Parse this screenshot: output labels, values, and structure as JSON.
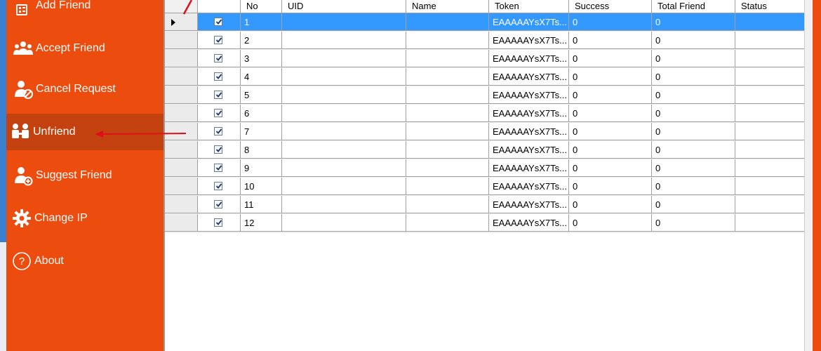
{
  "sidebar": {
    "items": [
      {
        "label": "Add Friend",
        "icon": "add-friend-icon",
        "active": false
      },
      {
        "label": "Accept Friend",
        "icon": "group-users-icon",
        "active": false
      },
      {
        "label": "Cancel Request",
        "icon": "user-cancel-icon",
        "active": false
      },
      {
        "label": "Unfriend",
        "icon": "unfriend-icon",
        "active": true
      },
      {
        "label": "Suggest Friend",
        "icon": "user-add-icon",
        "active": false
      },
      {
        "label": "Change IP",
        "icon": "gear-icon",
        "active": false
      },
      {
        "label": "About",
        "icon": "question-circle-icon",
        "active": false
      }
    ]
  },
  "grid": {
    "columns": [
      "",
      "No",
      "UID",
      "Name",
      "Token",
      "Success",
      "Total Friend",
      "Status"
    ],
    "rows": [
      {
        "no": "1",
        "uid": "",
        "name": "",
        "token": "EAAAAAYsX7Ts...",
        "success": "0",
        "total": "0",
        "status": "",
        "checked": true,
        "selected": true
      },
      {
        "no": "2",
        "uid": "",
        "name": "",
        "token": "EAAAAAYsX7Ts...",
        "success": "0",
        "total": "0",
        "status": "",
        "checked": true,
        "selected": false
      },
      {
        "no": "3",
        "uid": "",
        "name": "",
        "token": "EAAAAAYsX7Ts...",
        "success": "0",
        "total": "0",
        "status": "",
        "checked": true,
        "selected": false
      },
      {
        "no": "4",
        "uid": "",
        "name": "",
        "token": "EAAAAAYsX7Ts...",
        "success": "0",
        "total": "0",
        "status": "",
        "checked": true,
        "selected": false
      },
      {
        "no": "5",
        "uid": "",
        "name": "",
        "token": "EAAAAAYsX7Ts...",
        "success": "0",
        "total": "0",
        "status": "",
        "checked": true,
        "selected": false
      },
      {
        "no": "6",
        "uid": "",
        "name": "",
        "token": "EAAAAAYsX7Ts...",
        "success": "0",
        "total": "0",
        "status": "",
        "checked": true,
        "selected": false
      },
      {
        "no": "7",
        "uid": "",
        "name": "",
        "token": "EAAAAAYsX7Ts...",
        "success": "0",
        "total": "0",
        "status": "",
        "checked": true,
        "selected": false
      },
      {
        "no": "8",
        "uid": "",
        "name": "",
        "token": "EAAAAAYsX7Ts...",
        "success": "0",
        "total": "0",
        "status": "",
        "checked": true,
        "selected": false
      },
      {
        "no": "9",
        "uid": "",
        "name": "",
        "token": "EAAAAAYsX7Ts...",
        "success": "0",
        "total": "0",
        "status": "",
        "checked": true,
        "selected": false
      },
      {
        "no": "10",
        "uid": "",
        "name": "",
        "token": "EAAAAAYsX7Ts...",
        "success": "0",
        "total": "0",
        "status": "",
        "checked": true,
        "selected": false
      },
      {
        "no": "11",
        "uid": "",
        "name": "",
        "token": "EAAAAAYsX7Ts...",
        "success": "0",
        "total": "0",
        "status": "",
        "checked": true,
        "selected": false
      },
      {
        "no": "12",
        "uid": "",
        "name": "",
        "token": "EAAAAAYsX7Ts...",
        "success": "0",
        "total": "0",
        "status": "",
        "checked": true,
        "selected": false
      }
    ]
  },
  "colors": {
    "sidebar": "#ec4c0e",
    "sidebar_active": "#c4420f",
    "selection": "#3399ff",
    "annotation_arrow": "#e0101a"
  }
}
